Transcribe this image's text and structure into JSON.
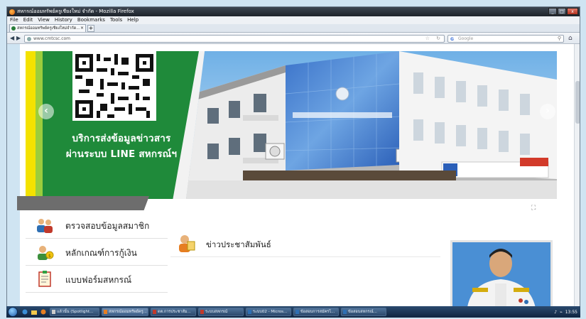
{
  "window": {
    "title": "สหกรณ์ออมทรัพย์ครูเชียงใหม่ จำกัด - Mozilla Firefox",
    "controls": [
      "_",
      "□",
      "x"
    ]
  },
  "menubar": [
    "File",
    "Edit",
    "View",
    "History",
    "Bookmarks",
    "Tools",
    "Help"
  ],
  "tabs": [
    {
      "label": "สหกรณ์ออมทรัพย์ครูเชียงใหม่จำกัด..."
    }
  ],
  "newtab_label": "+",
  "nav": {
    "back": "◀",
    "forward": "▶",
    "url": "www.cmtcsc.com",
    "search_placeholder": "Google",
    "search_engine_glyph": "G"
  },
  "banner": {
    "slogan_line1": "บริการส่งข้อมูลข่าวสาร",
    "slogan_line2": "ผ่านระบบ LINE สหกรณ์ฯ",
    "prev": "‹",
    "next": "›",
    "expand": "⛶"
  },
  "menu": [
    {
      "label": "ตรวจสอบข้อมูลสมาชิก",
      "icon": "members-icon"
    },
    {
      "label": "หลักเกณฑ์การกู้เงิน",
      "icon": "loan-icon"
    },
    {
      "label": "แบบฟอร์มสหกรณ์",
      "icon": "form-icon"
    }
  ],
  "news": {
    "label": "ข่าวประชาสัมพันธ์",
    "icon": "news-icon"
  },
  "taskbar": {
    "buttons": [
      {
        "label": "แล้วนั้น (Spotlight..."
      },
      {
        "label": "สหกรณ์ออมทรัพย์ครู..."
      },
      {
        "label": "ดต.การประชาสัม..."
      },
      {
        "label": "ระบบสหกรณ์"
      },
      {
        "label": "ระบบ02 - Micros..."
      },
      {
        "label": "ข้อสอบการสมัครโ..."
      },
      {
        "label": "ข้อสอบสหกรณ์..."
      }
    ],
    "time": "13:55"
  },
  "colors": {
    "banner_green": "#1f8a3a",
    "banner_yellow": "#f4e200",
    "banner_lightgreen": "#9ccd3c",
    "building_blue": "#2b5fb8"
  }
}
